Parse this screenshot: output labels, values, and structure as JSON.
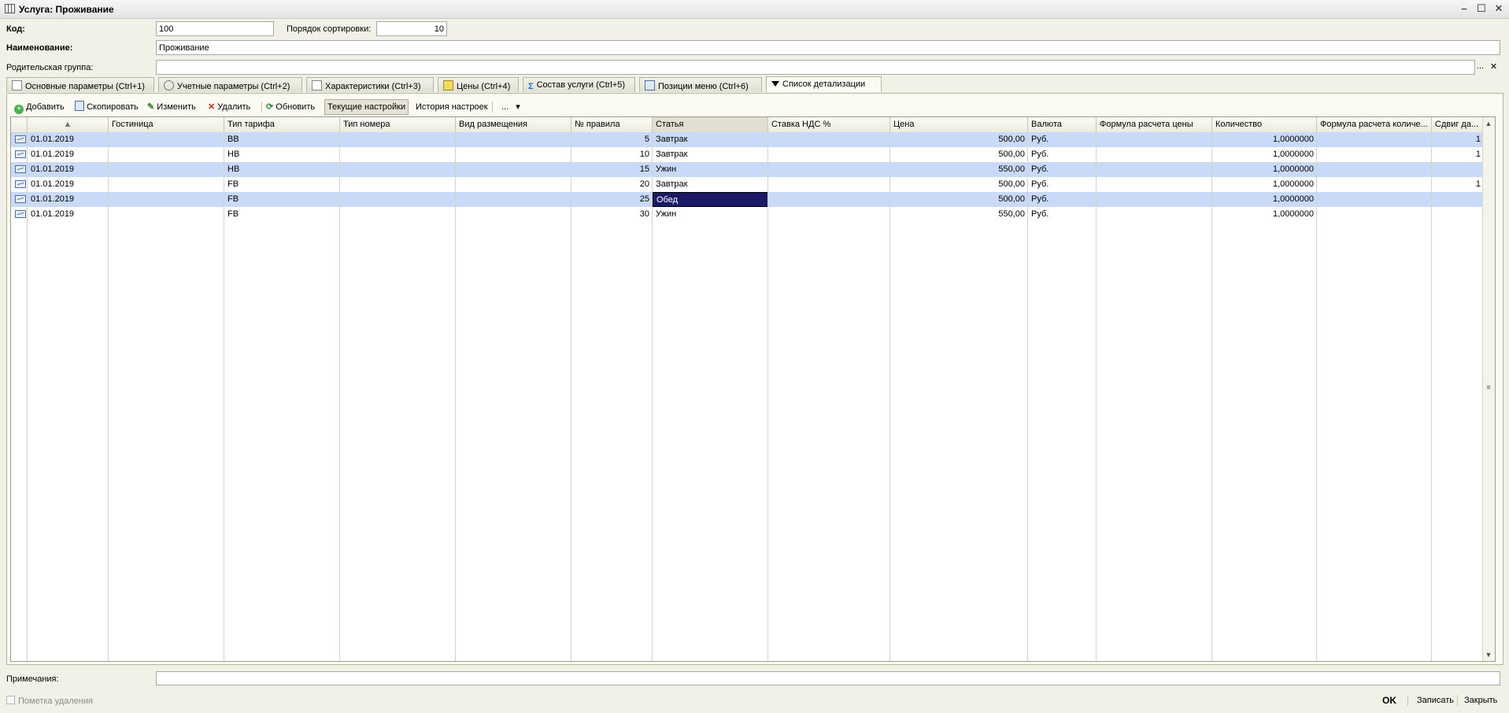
{
  "window": {
    "title": "Услуга: Проживание",
    "minimize": "⎯",
    "maximize": "☐",
    "close": "✕"
  },
  "form": {
    "code_label": "Код:",
    "code_value": "100",
    "sort_label": "Порядок сортировки:",
    "sort_value": "10",
    "name_label": "Наименование:",
    "name_value": "Проживание",
    "parent_label": "Родительская группа:",
    "parent_value": "",
    "parent_select": "...",
    "parent_clear": "✕",
    "notes_label": "Примечания:",
    "notes_value": ""
  },
  "tabs": [
    {
      "label": "Основные параметры (Ctrl+1)",
      "active": false
    },
    {
      "label": "Учетные параметры (Ctrl+2)",
      "active": false
    },
    {
      "label": "Характеристики (Ctrl+3)",
      "active": false
    },
    {
      "label": "Цены (Ctrl+4)",
      "active": false
    },
    {
      "label": "Состав услуги (Ctrl+5)",
      "active": false
    },
    {
      "label": "Позиции меню (Ctrl+6)",
      "active": false
    },
    {
      "label": "Список детализации",
      "active": true
    }
  ],
  "toolbar": {
    "add": "Добавить",
    "copy": "Скопировать",
    "edit": "Изменить",
    "delete": "Удалить",
    "refresh": "Обновить",
    "current_settings": "Текущие настройки",
    "settings_history": "История настроек",
    "more": "...",
    "more_arrow": "▾"
  },
  "table": {
    "columns": [
      "",
      "Гостиница",
      "Тип тарифа",
      "Тип номера",
      "Вид размещения",
      "№ правила",
      "Статья",
      "Ставка НДС %",
      "Цена",
      "Валюта",
      "Формула расчета цены",
      "Количество",
      "Формула расчета количе...",
      "Сдвиг да..."
    ],
    "sort_indicator": "▲",
    "rows": [
      {
        "date": "01.01.2019",
        "hotel": "",
        "tariff": "BB",
        "room": "",
        "placement": "",
        "rule": "5",
        "item": "Завтрак",
        "vat": "",
        "price": "500,00",
        "currency": "Руб.",
        "price_formula": "",
        "qty": "1,0000000",
        "qty_formula": "",
        "shift": "1"
      },
      {
        "date": "01.01.2019",
        "hotel": "",
        "tariff": "HB",
        "room": "",
        "placement": "",
        "rule": "10",
        "item": "Завтрак",
        "vat": "",
        "price": "500,00",
        "currency": "Руб.",
        "price_formula": "",
        "qty": "1,0000000",
        "qty_formula": "",
        "shift": "1"
      },
      {
        "date": "01.01.2019",
        "hotel": "",
        "tariff": "HB",
        "room": "",
        "placement": "",
        "rule": "15",
        "item": "Ужин",
        "vat": "",
        "price": "550,00",
        "currency": "Руб.",
        "price_formula": "",
        "qty": "1,0000000",
        "qty_formula": "",
        "shift": ""
      },
      {
        "date": "01.01.2019",
        "hotel": "",
        "tariff": "FB",
        "room": "",
        "placement": "",
        "rule": "20",
        "item": "Завтрак",
        "vat": "",
        "price": "500,00",
        "currency": "Руб.",
        "price_formula": "",
        "qty": "1,0000000",
        "qty_formula": "",
        "shift": "1"
      },
      {
        "date": "01.01.2019",
        "hotel": "",
        "tariff": "FB",
        "room": "",
        "placement": "",
        "rule": "25",
        "item": "Обед",
        "vat": "",
        "price": "500,00",
        "currency": "Руб.",
        "price_formula": "",
        "qty": "1,0000000",
        "qty_formula": "",
        "shift": ""
      },
      {
        "date": "01.01.2019",
        "hotel": "",
        "tariff": "FB",
        "room": "",
        "placement": "",
        "rule": "30",
        "item": "Ужин",
        "vat": "",
        "price": "550,00",
        "currency": "Руб.",
        "price_formula": "",
        "qty": "1,0000000",
        "qty_formula": "",
        "shift": ""
      }
    ],
    "selected_row": 4,
    "selected_column": "item"
  },
  "footer": {
    "deletion_mark": "Пометка удаления",
    "ok": "OK",
    "save": "Записать",
    "close": "Закрыть"
  },
  "colors": {
    "row_alt": "#c9d9f8",
    "selection": "#1a1a66",
    "panel": "#fbfaf3"
  }
}
